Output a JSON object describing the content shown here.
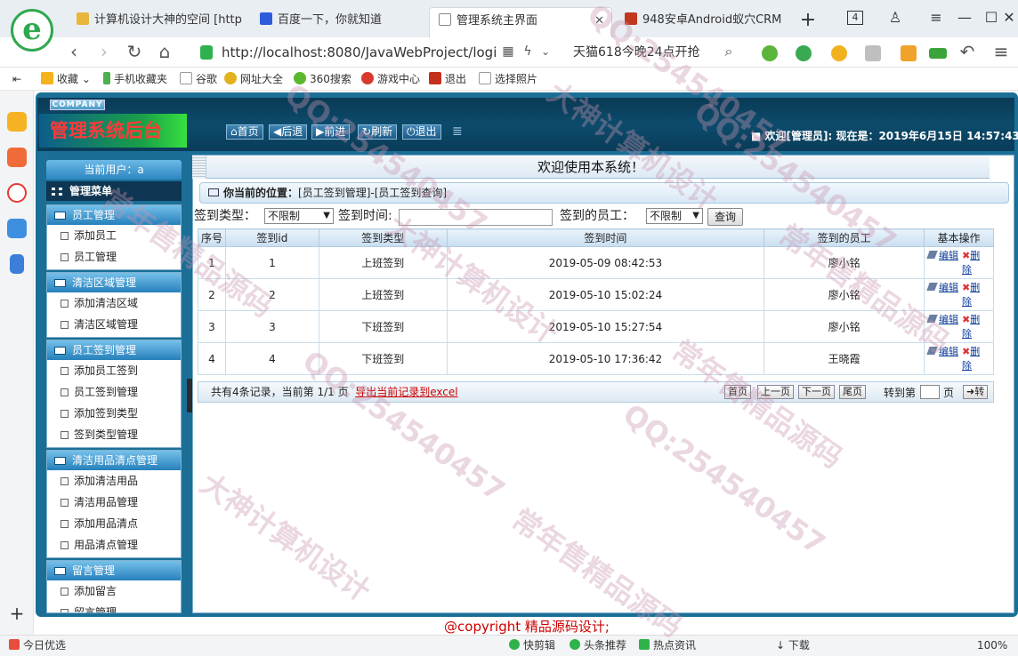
{
  "browser": {
    "tabs": [
      {
        "label": "计算机设计大神的空间 [http",
        "color": "#e8b63a"
      },
      {
        "label": "百度一下，你就知道",
        "color": "#2d5bdc"
      },
      {
        "label": "管理系统主界面",
        "color": "#888888"
      },
      {
        "label": "948安卓Android蚁穴CRM",
        "color": "#c3361e"
      }
    ],
    "tab_count": "4",
    "url": "http://localhost:8080/JavaWebProject/logi",
    "promo": "天猫618今晚24点开抢",
    "bookmarks": [
      "收藏",
      "手机收藏夹",
      "谷歌",
      "网址大全",
      "360搜索",
      "游戏中心",
      "退出",
      "选择照片"
    ],
    "status": {
      "left": "今日优选",
      "items": [
        "快剪辑",
        "头条推荐",
        "热点资讯",
        "下载"
      ],
      "zoom": "100%"
    }
  },
  "app": {
    "company": "COMPANY",
    "title": "管理系统后台",
    "nav": [
      "首页",
      "后退",
      "前进",
      "刷新",
      "退出"
    ],
    "welcome_top": "欢迎[管理员]:  现在是：2019年6月15日 14:57:43",
    "current_user": "当前用户：a",
    "menu_title": "管理菜单",
    "sections": [
      {
        "title": "员工管理",
        "items": [
          "添加员工",
          "员工管理"
        ]
      },
      {
        "title": "清洁区域管理",
        "items": [
          "添加清洁区域",
          "清洁区域管理"
        ]
      },
      {
        "title": "员工签到管理",
        "items": [
          "添加员工签到",
          "员工签到管理",
          "添加签到类型",
          "签到类型管理"
        ]
      },
      {
        "title": "清洁用品清点管理",
        "items": [
          "添加清洁用品",
          "清洁用品管理",
          "添加用品清点",
          "用品清点管理"
        ]
      },
      {
        "title": "留言管理",
        "items": [
          "添加留言",
          "留言管理"
        ]
      }
    ],
    "welcome_banner": "欢迎使用本系统！",
    "location_label": "你当前的位置：",
    "location_path": "[员工签到管理]-[员工签到查询]",
    "filter": {
      "type_label": "签到类型：",
      "type_value": "不限制",
      "time_label": "签到时间:",
      "time_value": "",
      "emp_label": "签到的员工：",
      "emp_value": "不限制",
      "query": "查询"
    },
    "table": {
      "headers": [
        "序号",
        "签到id",
        "签到类型",
        "签到时间",
        "签到的员工",
        "基本操作"
      ],
      "rows": [
        [
          "1",
          "1",
          "上班签到",
          "2019-05-09 08:42:53",
          "廖小铭"
        ],
        [
          "2",
          "2",
          "上班签到",
          "2019-05-10 15:02:24",
          "廖小铭"
        ],
        [
          "3",
          "3",
          "下班签到",
          "2019-05-10 15:27:54",
          "廖小铭"
        ],
        [
          "4",
          "4",
          "下班签到",
          "2019-05-10 17:36:42",
          "王晓霞"
        ]
      ],
      "edit": "编辑",
      "del1": "删",
      "del2": "除"
    },
    "pager": {
      "summary": "共有4条记录，当前第 1/1 页",
      "export": "导出当前记录到excel",
      "buttons": [
        "首页",
        "上一页",
        "下一页",
        "尾页"
      ],
      "goto": "转到第",
      "page_unit": "页",
      "go": "转"
    },
    "copyright": "@copyright 精品源码设计;"
  },
  "watermarks": [
    "QQ:254540457",
    "大神计算机设计",
    "常年售精品源码",
    "QQ:254540457",
    "大神计算机设计",
    "常年售精品源码",
    "QQ:254540457",
    "大神计算机设计"
  ]
}
